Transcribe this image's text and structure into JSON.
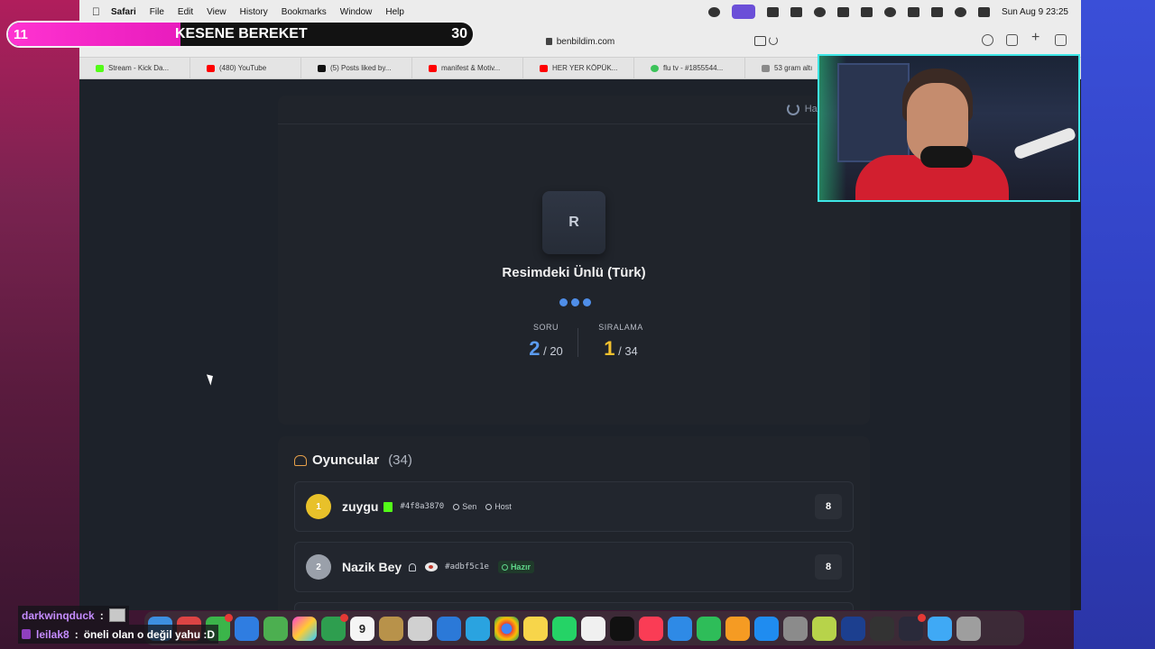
{
  "menubar": {
    "app": "Safari",
    "items": [
      "File",
      "Edit",
      "View",
      "History",
      "Bookmarks",
      "Window",
      "Help"
    ],
    "clock": "Sun Aug 9  23:25"
  },
  "overlay": {
    "goal_current": "11",
    "goal_title": "KESENE BEREKET",
    "goal_target": "30",
    "goal_fill_fraction": 0.37
  },
  "browser": {
    "url": "benbildim.com",
    "tabs": [
      {
        "label": "Stream - Kick Da...",
        "color": "#53fc18"
      },
      {
        "label": "(480) YouTube",
        "color": "#ff0000"
      },
      {
        "label": "(5) Posts liked by...",
        "color": "#111111"
      },
      {
        "label": "manifest & Motiv...",
        "color": "#ff0000"
      },
      {
        "label": "HER YER KÖPÜK...",
        "color": "#ff0000"
      },
      {
        "label": "flu tv - #1855544...",
        "color": "#3cc35a"
      },
      {
        "label": "53 gram altı",
        "color": "#8a8a8a"
      }
    ]
  },
  "game": {
    "status": "Hazır",
    "avatar_letter": "R",
    "category": "Resimdeki Ünlü (Türk)",
    "question_label": "SORU",
    "question_current": "2",
    "question_total": "/ 20",
    "rank_label": "SIRALAMA",
    "rank_current": "1",
    "rank_total": "/ 34",
    "accent_blue": "#5b9bf0",
    "accent_gold": "#f2c12e"
  },
  "players": {
    "title": "Oyuncular",
    "count": "(34)",
    "list": [
      {
        "rank": "1",
        "name": "zuygu",
        "id": "#4f8a3870",
        "tag_you": "Sen",
        "tag_host": "Host",
        "score": "8",
        "rank_color": "#e8c12a"
      },
      {
        "rank": "2",
        "name": "Nazik Bey",
        "id": "#adbf5c1e",
        "status": "Hazır",
        "score": "8",
        "rank_color": "#9aa0aa"
      }
    ]
  },
  "chat": [
    {
      "user": "darkwinqduck",
      "sep": ":",
      "user_color": "#c58cff",
      "message": ""
    },
    {
      "user": "leilak8",
      "sep": ":",
      "user_color": "#c58cff",
      "message": "öneli olan o değil yahu :D"
    }
  ],
  "dock": {
    "calendar_month": "AUG",
    "calendar_day": "9"
  }
}
